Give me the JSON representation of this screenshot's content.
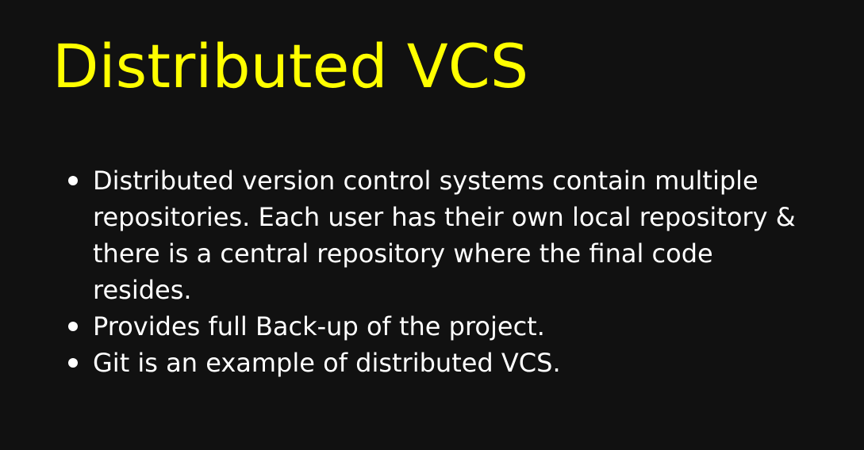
{
  "slide": {
    "title": "Distributed VCS",
    "title_color": "#ffff00",
    "background_color": "#111111",
    "bullets": [
      "Distributed version control systems contain multiple repositories. Each user has their own local repository & there is a central repository where the final code resides.",
      "Provides full Back-up of the project.",
      "Git is an example of distributed VCS."
    ]
  }
}
